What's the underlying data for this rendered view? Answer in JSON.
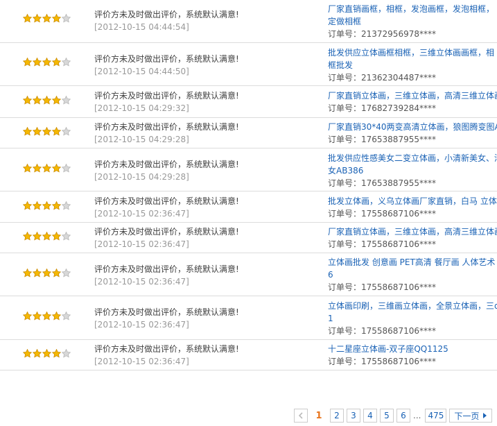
{
  "rows": [
    {
      "comment": "评价方未及时做出评价，系统默认满意!",
      "time": "[2012-10-15 04:44:54]",
      "title_lines": [
        "厂家直销画框，相框，发泡画框，发泡相框，",
        "定做相框"
      ],
      "order": "订单号：21372956978****"
    },
    {
      "comment": "评价方未及时做出评价，系统默认满意!",
      "time": "[2012-10-15 04:44:50]",
      "title_lines": [
        "批发供应立体画框相框，三维立体画画框，相",
        "框批发"
      ],
      "order": "订单号：21362304487****"
    },
    {
      "comment": "评价方未及时做出评价，系统默认满意!",
      "time": "[2012-10-15 04:29:32]",
      "title_lines": [
        "厂家直销立体画，三维立体画，高清三维立体画"
      ],
      "order": "订单号：17682739284****"
    },
    {
      "comment": "评价方未及时做出评价，系统默认满意!",
      "time": "[2012-10-15 04:29:28]",
      "title_lines": [
        "厂家直销30*40两变高清立体画，狼图腾变图A"
      ],
      "order": "订单号：17653887955****"
    },
    {
      "comment": "评价方未及时做出评价，系统默认满意!",
      "time": "[2012-10-15 04:29:28]",
      "title_lines": [
        "批发供应性感美女二变立体画，小清新美女、清",
        "女AB386"
      ],
      "order": "订单号：17653887955****"
    },
    {
      "comment": "评价方未及时做出评价，系统默认满意!",
      "time": "[2012-10-15 02:36:47]",
      "title_lines": [
        "批发立体画，义乌立体画厂家直销，白马 立体"
      ],
      "order": "订单号：17558687106****"
    },
    {
      "comment": "评价方未及时做出评价，系统默认满意!",
      "time": "[2012-10-15 02:36:47]",
      "title_lines": [
        "厂家直销立体画，三维立体画，高清三维立体画"
      ],
      "order": "订单号：17558687106****"
    },
    {
      "comment": "评价方未及时做出评价，系统默认满意!",
      "time": "[2012-10-15 02:36:47]",
      "title_lines": [
        "立体画批发 创意画 PET高清 餐厅画 人体艺术",
        "6"
      ],
      "order": "订单号：17558687106****"
    },
    {
      "comment": "评价方未及时做出评价，系统默认满意!",
      "time": "[2012-10-15 02:36:47]",
      "title_lines": [
        "立体画印刷，三维画立体画，全景立体画，三d",
        "1"
      ],
      "order": "订单号：17558687106****"
    },
    {
      "comment": "评价方未及时做出评价，系统默认满意!",
      "time": "[2012-10-15 02:36:47]",
      "title_lines": [
        "十二星座立体画-双子座QQ1125"
      ],
      "order": "订单号：17558687106****"
    }
  ],
  "rating": {
    "filled": 4,
    "total": 5
  },
  "colors": {
    "star_fill": "#f5b800",
    "star_empty": "#d8d8d8",
    "link": "#1a62b5",
    "current_page": "#e8741c"
  },
  "pager": {
    "prev_icon": "chevron-left-icon",
    "current": "1",
    "pages": [
      "2",
      "3",
      "4",
      "5",
      "6"
    ],
    "ellipsis": "...",
    "last": "475",
    "next_label": "下一页",
    "next_icon": "caret-right-icon"
  }
}
